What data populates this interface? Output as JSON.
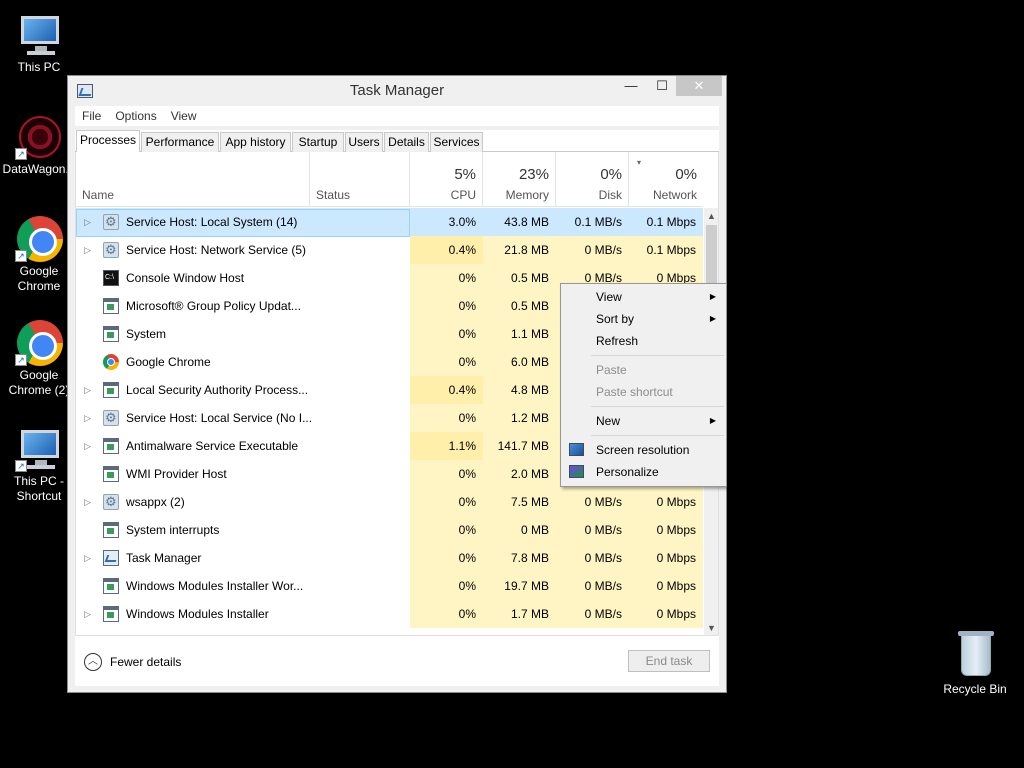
{
  "desktop": {
    "icons": [
      {
        "label": "This PC"
      },
      {
        "label": "DataWagon..."
      },
      {
        "label": "Google Chrome"
      },
      {
        "label": "Google Chrome (2)"
      },
      {
        "label": "This PC - Shortcut"
      },
      {
        "label": "Recycle Bin"
      }
    ]
  },
  "window": {
    "title": "Task Manager",
    "controls": {
      "minimize": "—",
      "maximize": "☐",
      "close": "✕"
    },
    "menu": [
      "File",
      "Options",
      "View"
    ],
    "tabs": [
      "Processes",
      "Performance",
      "App history",
      "Startup",
      "Users",
      "Details",
      "Services"
    ],
    "active_tab": "Processes"
  },
  "columns": {
    "name": "Name",
    "status": "Status",
    "cpu": {
      "pct": "5%",
      "label": "CPU"
    },
    "memory": {
      "pct": "23%",
      "label": "Memory"
    },
    "disk": {
      "pct": "0%",
      "label": "Disk"
    },
    "network": {
      "pct": "0%",
      "label": "Network"
    }
  },
  "processes": [
    {
      "name": "Service Host: Local System (14)",
      "expand": "▷",
      "icon": "gear-icon",
      "cpu": "3.0%",
      "mem": "43.8 MB",
      "disk": "0.1 MB/s",
      "net": "0.1 Mbps"
    },
    {
      "name": "Service Host: Network Service (5)",
      "expand": "▷",
      "icon": "gear-icon",
      "cpu": "0.4%",
      "mem": "21.8 MB",
      "disk": "0 MB/s",
      "net": "0.1 Mbps"
    },
    {
      "name": "Console Window Host",
      "expand": "",
      "icon": "console-icon",
      "cpu": "0%",
      "mem": "0.5 MB",
      "disk": "0 MB/s",
      "net": "0 Mbps"
    },
    {
      "name": "Microsoft® Group Policy Updat...",
      "expand": "",
      "icon": "window-icon",
      "cpu": "0%",
      "mem": "0.5 MB",
      "disk": "",
      "net": ""
    },
    {
      "name": "System",
      "expand": "",
      "icon": "window-icon",
      "cpu": "0%",
      "mem": "1.1 MB",
      "disk": "",
      "net": ""
    },
    {
      "name": "Google Chrome",
      "expand": "",
      "icon": "chrome-icon",
      "cpu": "0%",
      "mem": "6.0 MB",
      "disk": "",
      "net": ""
    },
    {
      "name": "Local Security Authority Process...",
      "expand": "▷",
      "icon": "window-icon",
      "cpu": "0.4%",
      "mem": "4.8 MB",
      "disk": "",
      "net": ""
    },
    {
      "name": "Service Host: Local Service (No I...",
      "expand": "▷",
      "icon": "gear-icon",
      "cpu": "0%",
      "mem": "1.2 MB",
      "disk": "",
      "net": ""
    },
    {
      "name": "Antimalware Service Executable",
      "expand": "▷",
      "icon": "window-icon",
      "cpu": "1.1%",
      "mem": "141.7 MB",
      "disk": "",
      "net": ""
    },
    {
      "name": "WMI Provider Host",
      "expand": "",
      "icon": "window-icon",
      "cpu": "0%",
      "mem": "2.0 MB",
      "disk": "",
      "net": ""
    },
    {
      "name": "wsappx (2)",
      "expand": "▷",
      "icon": "gear-icon",
      "cpu": "0%",
      "mem": "7.5 MB",
      "disk": "0 MB/s",
      "net": "0 Mbps"
    },
    {
      "name": "System interrupts",
      "expand": "",
      "icon": "window-icon",
      "cpu": "0%",
      "mem": "0 MB",
      "disk": "0 MB/s",
      "net": "0 Mbps"
    },
    {
      "name": "Task Manager",
      "expand": "▷",
      "icon": "task-manager-icon",
      "cpu": "0%",
      "mem": "7.8 MB",
      "disk": "0 MB/s",
      "net": "0 Mbps"
    },
    {
      "name": "Windows Modules Installer Wor...",
      "expand": "",
      "icon": "window-icon",
      "cpu": "0%",
      "mem": "19.7 MB",
      "disk": "0 MB/s",
      "net": "0 Mbps"
    },
    {
      "name": "Windows Modules Installer",
      "expand": "▷",
      "icon": "window-icon",
      "cpu": "0%",
      "mem": "1.7 MB",
      "disk": "0 MB/s",
      "net": "0 Mbps"
    }
  ],
  "footer": {
    "fewer_details": "Fewer details",
    "end_task": "End task"
  },
  "context_menu": {
    "items": [
      {
        "label": "View",
        "submenu": true,
        "disabled": false
      },
      {
        "label": "Sort by",
        "submenu": true,
        "disabled": false
      },
      {
        "label": "Refresh",
        "submenu": false,
        "disabled": false
      },
      {
        "label": "Paste",
        "submenu": false,
        "disabled": true
      },
      {
        "label": "Paste shortcut",
        "submenu": false,
        "disabled": true
      },
      {
        "label": "New",
        "submenu": true,
        "disabled": false
      },
      {
        "label": "Screen resolution",
        "submenu": false,
        "disabled": false,
        "icon": "display-icon"
      },
      {
        "label": "Personalize",
        "submenu": false,
        "disabled": false,
        "icon": "personalize-icon"
      }
    ]
  },
  "colors": {
    "selected_row": "#cce8ff",
    "heat_light": "#fff4c4",
    "heat_medium": "#ffefab",
    "desktop_bg": "#000000"
  }
}
